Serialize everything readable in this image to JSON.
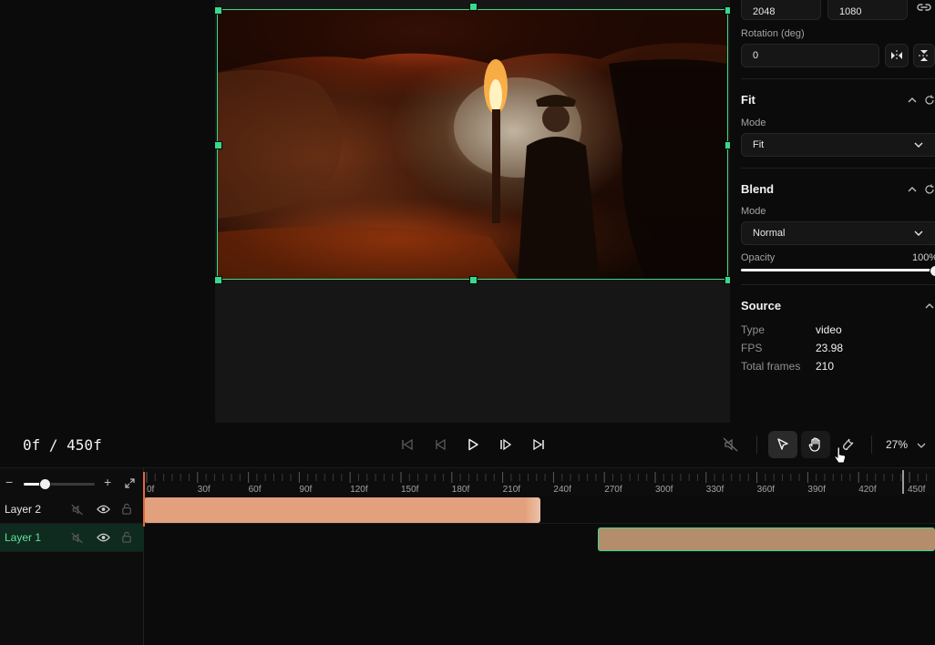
{
  "panel": {
    "size": {
      "width": "2048",
      "height": "1080"
    },
    "rotation": {
      "label": "Rotation (deg)",
      "value": "0"
    },
    "fit": {
      "title": "Fit",
      "mode_label": "Mode",
      "mode_value": "Fit"
    },
    "blend": {
      "title": "Blend",
      "mode_label": "Mode",
      "mode_value": "Normal",
      "opacity_label": "Opacity",
      "opacity_value": "100%",
      "opacity_level": 1.0
    },
    "source": {
      "title": "Source",
      "rows": [
        {
          "key": "Type",
          "value": "video"
        },
        {
          "key": "FPS",
          "value": "23.98"
        },
        {
          "key": "Total frames",
          "value": "210"
        }
      ]
    }
  },
  "transport": {
    "timecode": "0f / 450f",
    "zoom": "27%"
  },
  "timeline": {
    "ticks": [
      "0f",
      "30f",
      "60f",
      "90f",
      "120f",
      "150f",
      "180f",
      "210f",
      "240f",
      "270f",
      "300f",
      "330f",
      "360f",
      "390f",
      "420f",
      "450f"
    ],
    "tracks": [
      {
        "name": "Layer 2",
        "selected": false
      },
      {
        "name": "Layer 1",
        "selected": true
      }
    ],
    "colors": {
      "accent": "#39d98a",
      "clip_layer2": "#e3a07d",
      "clip_layer1": "#b48d6d",
      "playhead": "#e06a3a"
    }
  }
}
